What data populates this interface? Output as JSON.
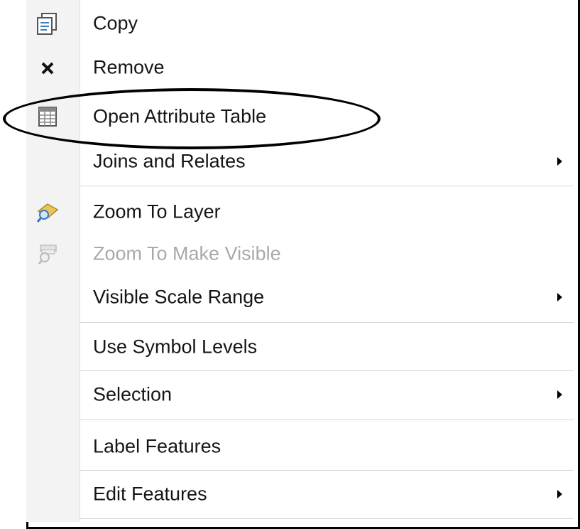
{
  "menu": {
    "items": [
      {
        "label": "Copy",
        "icon": "copy-icon",
        "enabled": true,
        "submenu": false
      },
      {
        "label": "Remove",
        "icon": "remove-x-icon",
        "enabled": true,
        "submenu": false
      },
      {
        "label": "Open Attribute Table",
        "icon": "table-icon",
        "enabled": true,
        "submenu": false
      },
      {
        "label": "Joins and Relates",
        "icon": "",
        "enabled": true,
        "submenu": true
      },
      {
        "label": "Zoom To Layer",
        "icon": "zoom-to-layer-icon",
        "enabled": true,
        "submenu": false
      },
      {
        "label": "Zoom To Make Visible",
        "icon": "zoom-to-make-visible-icon",
        "enabled": false,
        "submenu": false
      },
      {
        "label": "Visible Scale Range",
        "icon": "",
        "enabled": true,
        "submenu": true
      },
      {
        "label": "Use Symbol Levels",
        "icon": "",
        "enabled": true,
        "submenu": false
      },
      {
        "label": "Selection",
        "icon": "",
        "enabled": true,
        "submenu": true
      },
      {
        "label": "Label Features",
        "icon": "",
        "enabled": true,
        "submenu": false
      },
      {
        "label": "Edit Features",
        "icon": "",
        "enabled": true,
        "submenu": true
      }
    ]
  },
  "annotation": {
    "highlighted_item": "Open Attribute Table",
    "shape": "ellipse",
    "color": "#000000"
  },
  "colors": {
    "text": "#151515",
    "disabled_text": "#a9a9a9",
    "gutter": "#f3f3f3",
    "border": "#000000"
  }
}
